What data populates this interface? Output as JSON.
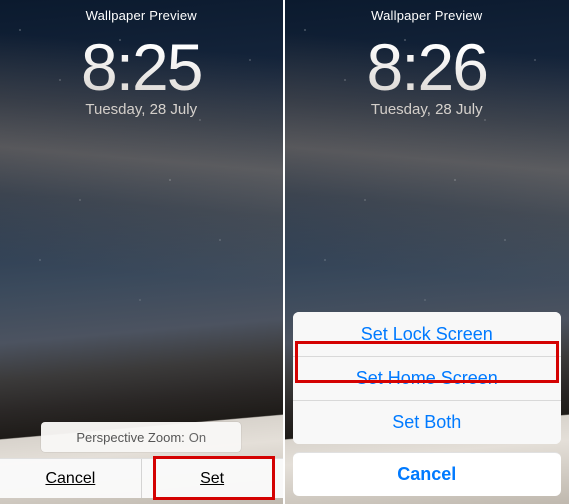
{
  "left": {
    "title": "Wallpaper Preview",
    "time": "8:25",
    "date": "Tuesday, 28 July",
    "perspective_label": "Perspective Zoom:",
    "perspective_value": "On",
    "cancel": "Cancel",
    "set": "Set"
  },
  "right": {
    "title": "Wallpaper Preview",
    "time": "8:26",
    "date": "Tuesday, 28 July",
    "actions": {
      "lock": "Set Lock Screen",
      "home": "Set Home Screen",
      "both": "Set Both",
      "cancel": "Cancel"
    }
  },
  "colors": {
    "ios_blue": "#007aff",
    "highlight_red": "#d40202"
  }
}
